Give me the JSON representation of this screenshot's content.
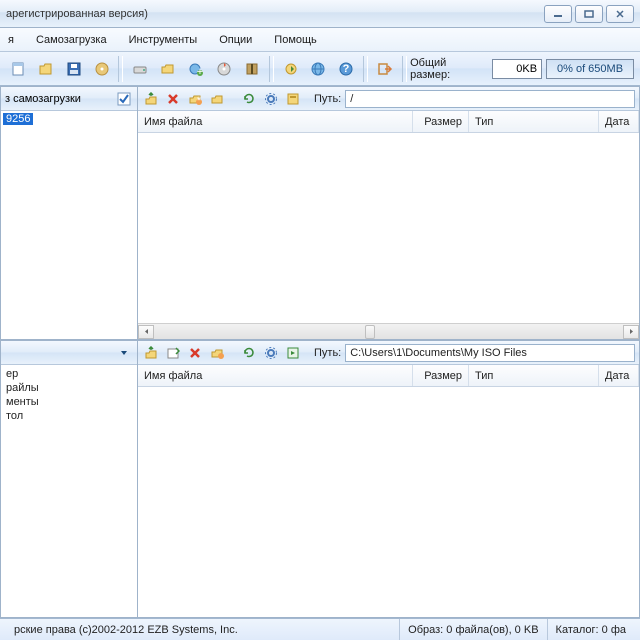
{
  "title": "арегистрированная версия)",
  "menu": {
    "m1": "я",
    "m2": "Самозагрузка",
    "m3": "Инструменты",
    "m4": "Опции",
    "m5": "Помощь"
  },
  "toolbar": {
    "total_label": "Общий размер:",
    "total_value": "0KB",
    "progress": "0% of 650MB"
  },
  "top": {
    "left_head": "з самозагрузки",
    "selected": "9256",
    "path_label": "Путь:",
    "path_value": "/",
    "cols": {
      "name": "Имя файла",
      "size": "Размер",
      "type": "Тип",
      "date": "Дата"
    }
  },
  "bot": {
    "tree": [
      "ер",
      "райлы",
      "менты",
      "тол"
    ],
    "path_label": "Путь:",
    "path_value": "C:\\Users\\1\\Documents\\My ISO Files",
    "cols": {
      "name": "Имя файла",
      "size": "Размер",
      "type": "Тип",
      "date": "Дата"
    }
  },
  "status": {
    "copyright": "рские права (c)2002-2012 EZB Systems, Inc.",
    "image": "Образ: 0 файла(ов), 0 KB",
    "catalog": "Каталог: 0 фа"
  }
}
